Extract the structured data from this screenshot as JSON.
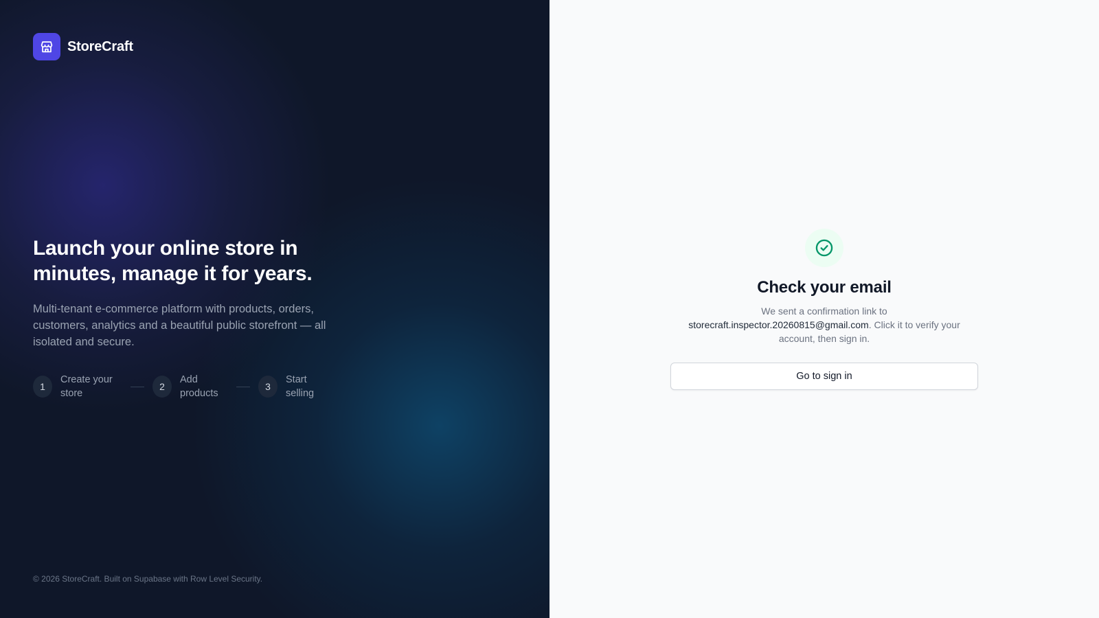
{
  "brand": {
    "name": "StoreCraft",
    "logo_icon": "storefront-icon",
    "logo_color": "#4f46e5"
  },
  "hero": {
    "title": "Launch your online store in minutes, manage it for years.",
    "subtitle": "Multi-tenant e-commerce platform with products, orders, customers, analytics and a beautiful public storefront — all isolated and secure.",
    "steps": [
      {
        "number": "1",
        "label": "Create your store"
      },
      {
        "number": "2",
        "label": "Add products"
      },
      {
        "number": "3",
        "label": "Start selling"
      }
    ],
    "footer": "© 2026 StoreCraft. Built on Supabase with Row Level Security."
  },
  "confirmation": {
    "icon": "check-circle-icon",
    "icon_color": "#059669",
    "title": "Check your email",
    "message_prefix": "We sent a confirmation link to",
    "email": "storecraft.inspector.20260815@gmail.com",
    "message_suffix": ". Click it to verify your account, then sign in.",
    "button_label": "Go to sign in"
  }
}
